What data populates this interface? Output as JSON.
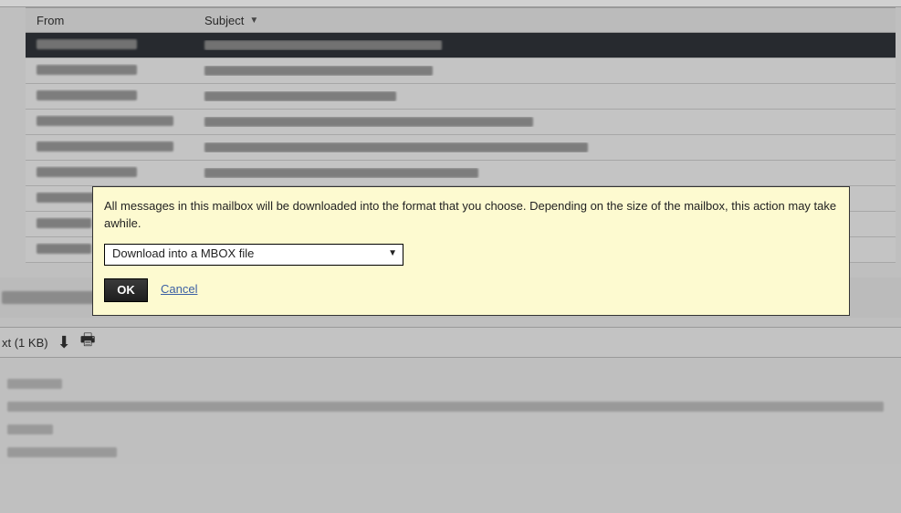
{
  "list": {
    "header": {
      "from": "From",
      "subject": "Subject"
    }
  },
  "preview": {
    "attachment_suffix": "xt (1 KB)"
  },
  "dialog": {
    "message": "All messages in this mailbox will be downloaded into the format that you choose. Depending on the size of the mailbox, this action may take awhile.",
    "selected_option": "Download into a MBOX file",
    "ok_label": "OK",
    "cancel_label": "Cancel"
  }
}
